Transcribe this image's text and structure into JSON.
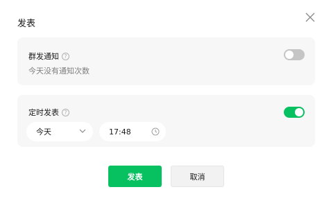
{
  "dialog": {
    "title": "发表"
  },
  "broadcast": {
    "label": "群发通知",
    "hint": "今天没有通知次数",
    "enabled": false
  },
  "schedule": {
    "label": "定时发表",
    "enabled": true,
    "date_value": "今天",
    "time_value": "17:48"
  },
  "actions": {
    "publish_label": "发表",
    "cancel_label": "取消"
  },
  "colors": {
    "accent": "#07c160",
    "toggle_off": "#c5c5c5",
    "card_bg": "#f7f7f7"
  },
  "icons": {
    "close": "close-icon",
    "help": "question-circle-icon",
    "chevron": "chevron-down-icon",
    "clock": "clock-icon"
  }
}
